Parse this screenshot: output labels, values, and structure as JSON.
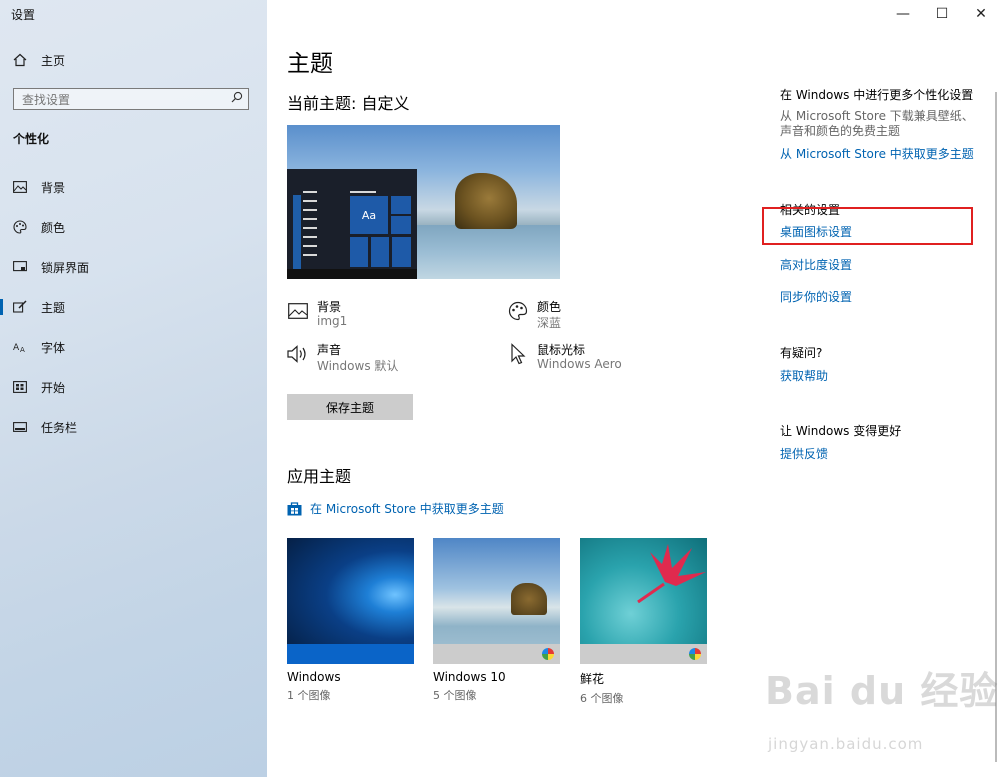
{
  "window": {
    "title": "设置",
    "minimize": "—",
    "maximize": "☐",
    "close": "✕"
  },
  "sidebar": {
    "home": {
      "icon": "home-icon",
      "label": "主页"
    },
    "search": {
      "placeholder": "查找设置"
    },
    "section": "个性化",
    "items": [
      {
        "icon": "image-icon",
        "label": "背景"
      },
      {
        "icon": "palette-icon",
        "label": "颜色"
      },
      {
        "icon": "lock-screen-icon",
        "label": "锁屏界面"
      },
      {
        "icon": "theme-brush-icon",
        "label": "主题",
        "active": true
      },
      {
        "icon": "font-icon",
        "label": "字体"
      },
      {
        "icon": "start-icon",
        "label": "开始"
      },
      {
        "icon": "taskbar-icon",
        "label": "任务栏"
      }
    ]
  },
  "main": {
    "title": "主题",
    "current_theme": "当前主题: 自定义",
    "preview": {
      "tile_label": "Aa"
    },
    "properties": [
      {
        "icon": "image-icon",
        "name": "背景",
        "value": "img1"
      },
      {
        "icon": "palette-icon",
        "name": "颜色",
        "value": "深蓝"
      },
      {
        "icon": "speaker-icon",
        "name": "声音",
        "value": "Windows 默认"
      },
      {
        "icon": "cursor-icon",
        "name": "鼠标光标",
        "value": "Windows Aero"
      }
    ],
    "save_button": "保存主题",
    "apply_title": "应用主题",
    "store_link": "在 Microsoft Store 中获取更多主题",
    "themes": [
      {
        "name": "Windows",
        "count": "1 个图像"
      },
      {
        "name": "Windows 10",
        "count": "5 个图像"
      },
      {
        "name": "鲜花",
        "count": "6 个图像"
      }
    ]
  },
  "right": {
    "more_head": "在 Windows 中进行更多个性化设置",
    "more_desc": "从 Microsoft Store 下载兼具壁纸、声音和颜色的免费主题",
    "more_link": "从 Microsoft Store 中获取更多主题",
    "related_head": "相关的设置",
    "desktop_icons": "桌面图标设置",
    "high_contrast": "高对比度设置",
    "sync": "同步你的设置",
    "question_head": "有疑问?",
    "get_help": "获取帮助",
    "better_head": "让 Windows 变得更好",
    "feedback": "提供反馈"
  },
  "watermark": {
    "line1": "Bai du 经验",
    "line2": "jingyan.baidu.com"
  },
  "colors": {
    "accent": "#0063b1",
    "highlight": "#e02020"
  }
}
